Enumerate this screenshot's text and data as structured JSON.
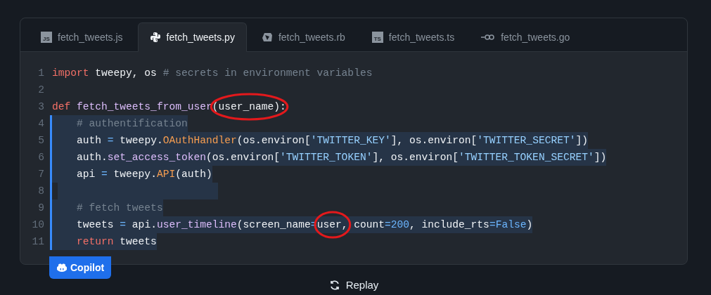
{
  "tabs": [
    {
      "label": "fetch_tweets.js",
      "selected": false,
      "kind": "badge",
      "badge": "JS"
    },
    {
      "label": "fetch_tweets.py",
      "selected": true,
      "kind": "python"
    },
    {
      "label": "fetch_tweets.rb",
      "selected": false,
      "kind": "ruby"
    },
    {
      "label": "fetch_tweets.ts",
      "selected": false,
      "kind": "badge",
      "badge": "TS"
    },
    {
      "label": "fetch_tweets.go",
      "selected": false,
      "kind": "go"
    }
  ],
  "code": {
    "lines": [
      {
        "number": "1",
        "highlighted": false,
        "tokens": [
          {
            "t": "import",
            "kind": "keyword"
          },
          {
            "t": " tweepy, os ",
            "kind": "plain"
          },
          {
            "t": "# secrets in environment variables",
            "kind": "comment"
          }
        ]
      },
      {
        "number": "2",
        "highlighted": false
      },
      {
        "number": "3",
        "highlighted": false,
        "tokens": [
          {
            "t": "def ",
            "kind": "keyword"
          },
          {
            "t": "fetch_tweets_from_user",
            "kind": "function"
          },
          {
            "t": "(user_name):",
            "kind": "plain",
            "circled": true
          }
        ]
      },
      {
        "number": "4",
        "highlighted": true,
        "tokens": [
          {
            "t": "    # authentification",
            "kind": "comment"
          }
        ]
      },
      {
        "number": "5",
        "highlighted": true,
        "tokens": [
          {
            "t": "    auth ",
            "kind": "plain"
          },
          {
            "t": "=",
            "kind": "operator"
          },
          {
            "t": " tweepy.",
            "kind": "plain"
          },
          {
            "t": "OAuthHandler",
            "kind": "class"
          },
          {
            "t": "(os.environ[",
            "kind": "plain"
          },
          {
            "t": "'TWITTER_KEY'",
            "kind": "string"
          },
          {
            "t": "], os.environ[",
            "kind": "plain"
          },
          {
            "t": "'TWITTER_SECRET'",
            "kind": "string"
          },
          {
            "t": "])",
            "kind": "plain"
          }
        ]
      },
      {
        "number": "6",
        "highlighted": true,
        "tokens": [
          {
            "t": "    auth.",
            "kind": "plain"
          },
          {
            "t": "set_access_token",
            "kind": "function"
          },
          {
            "t": "(os.environ[",
            "kind": "plain"
          },
          {
            "t": "'TWITTER_TOKEN'",
            "kind": "string"
          },
          {
            "t": "], os.environ[",
            "kind": "plain"
          },
          {
            "t": "'TWITTER_TOKEN_SECRET'",
            "kind": "string"
          },
          {
            "t": "])",
            "kind": "plain"
          }
        ]
      },
      {
        "number": "7",
        "highlighted": true,
        "tokens": [
          {
            "t": "    api ",
            "kind": "plain"
          },
          {
            "t": "=",
            "kind": "operator"
          },
          {
            "t": " tweepy.",
            "kind": "plain"
          },
          {
            "t": "API",
            "kind": "class"
          },
          {
            "t": "(auth)",
            "kind": "plain"
          }
        ]
      },
      {
        "number": "8",
        "highlighted": true
      },
      {
        "number": "9",
        "highlighted": true,
        "tokens": [
          {
            "t": "    # fetch tweets",
            "kind": "comment"
          }
        ]
      },
      {
        "number": "10",
        "highlighted": true,
        "tokens": [
          {
            "t": "    tweets ",
            "kind": "plain"
          },
          {
            "t": "=",
            "kind": "operator"
          },
          {
            "t": " api.",
            "kind": "plain"
          },
          {
            "t": "user_timeline",
            "kind": "function"
          },
          {
            "t": "(screen_name",
            "kind": "plain"
          },
          {
            "t": "=",
            "kind": "operator"
          },
          {
            "t": "user,",
            "kind": "plain",
            "circled": true
          },
          {
            "t": " count",
            "kind": "plain"
          },
          {
            "t": "=",
            "kind": "operator"
          },
          {
            "t": "200",
            "kind": "number"
          },
          {
            "t": ", include_rts",
            "kind": "plain"
          },
          {
            "t": "=",
            "kind": "operator"
          },
          {
            "t": "False",
            "kind": "number"
          },
          {
            "t": ")",
            "kind": "plain"
          }
        ]
      },
      {
        "number": "11",
        "highlighted": true,
        "tokens": [
          {
            "t": "    return",
            "kind": "keyword"
          },
          {
            "t": " tweets",
            "kind": "plain"
          }
        ]
      }
    ]
  },
  "copilot_button": {
    "label": "Copilot"
  },
  "replay_button": {
    "label": "Replay"
  }
}
